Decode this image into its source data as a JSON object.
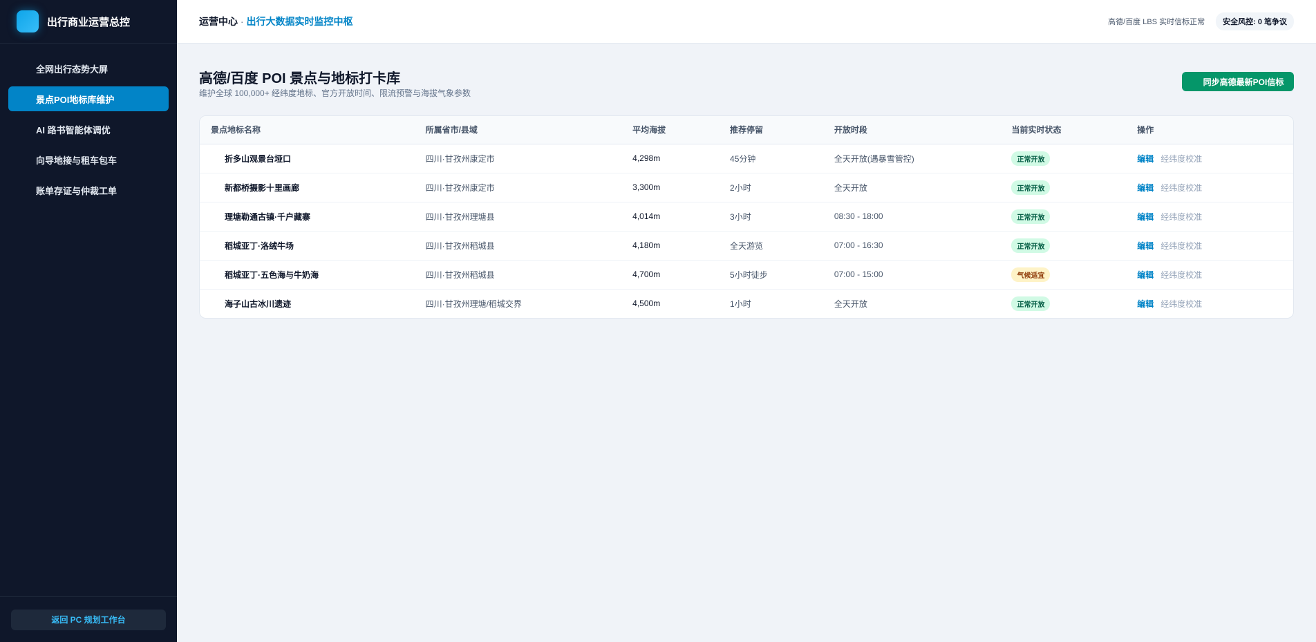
{
  "sidebar": {
    "brand": "出行商业运营总控",
    "items": [
      {
        "label": "全网出行态势大屏",
        "active": false
      },
      {
        "label": "景点POI地标库维护",
        "active": true
      },
      {
        "label": "AI 路书智能体调优",
        "active": false
      },
      {
        "label": "向导地接与租车包车",
        "active": false
      },
      {
        "label": "账单存证与仲裁工单",
        "active": false
      }
    ],
    "back_label": "返回 PC 规划工作台"
  },
  "header": {
    "crumb_root": "运营中心",
    "crumb_sep": " · ",
    "crumb_current": "出行大数据实时监控中枢",
    "lbs_status": "高德/百度 LBS 实时信标正常",
    "risk_badge": "安全风控: 0 笔争议"
  },
  "page": {
    "title": "高德/百度 POI 景点与地标打卡库",
    "subtitle": "维护全球 100,000+ 经纬度地标、官方开放时间、限流预警与海拔气象参数",
    "sync_button": "同步高德最新POI信标"
  },
  "table": {
    "headers": {
      "name": "景点地标名称",
      "region": "所属省市/县域",
      "altitude": "平均海拔",
      "stay": "推荐停留",
      "hours": "开放时段",
      "status": "当前实时状态",
      "actions": "操作"
    },
    "rows": [
      {
        "name": "折多山观景台垭口",
        "region": "四川·甘孜州康定市",
        "altitude": "4,298m",
        "stay": "45分钟",
        "hours": "全天开放(遇暴雪管控)",
        "status": "正常开放",
        "status_kind": "open",
        "edit": "编辑",
        "calibrate": "经纬度校准"
      },
      {
        "name": "新都桥摄影十里画廊",
        "region": "四川·甘孜州康定市",
        "altitude": "3,300m",
        "stay": "2小时",
        "hours": "全天开放",
        "status": "正常开放",
        "status_kind": "open",
        "edit": "编辑",
        "calibrate": "经纬度校准"
      },
      {
        "name": "理塘勒通古镇·千户藏寨",
        "region": "四川·甘孜州理塘县",
        "altitude": "4,014m",
        "stay": "3小时",
        "hours": "08:30 - 18:00",
        "status": "正常开放",
        "status_kind": "open",
        "edit": "编辑",
        "calibrate": "经纬度校准"
      },
      {
        "name": "稻城亚丁·洛绒牛场",
        "region": "四川·甘孜州稻城县",
        "altitude": "4,180m",
        "stay": "全天游览",
        "hours": "07:00 - 16:30",
        "status": "正常开放",
        "status_kind": "open",
        "edit": "编辑",
        "calibrate": "经纬度校准"
      },
      {
        "name": "稻城亚丁·五色海与牛奶海",
        "region": "四川·甘孜州稻城县",
        "altitude": "4,700m",
        "stay": "5小时徒步",
        "hours": "07:00 - 15:00",
        "status": "气候适宜",
        "status_kind": "warn",
        "edit": "编辑",
        "calibrate": "经纬度校准"
      },
      {
        "name": "海子山古冰川遗迹",
        "region": "四川·甘孜州理塘/稻城交界",
        "altitude": "4,500m",
        "stay": "1小时",
        "hours": "全天开放",
        "status": "正常开放",
        "status_kind": "open",
        "edit": "编辑",
        "calibrate": "经纬度校准"
      }
    ]
  },
  "colors": {
    "sidebar_bg": "#0f172a",
    "accent": "#0284c7",
    "sync_button": "#059669",
    "badge_open": "#d1fae5",
    "badge_warn": "#fef3c7"
  }
}
